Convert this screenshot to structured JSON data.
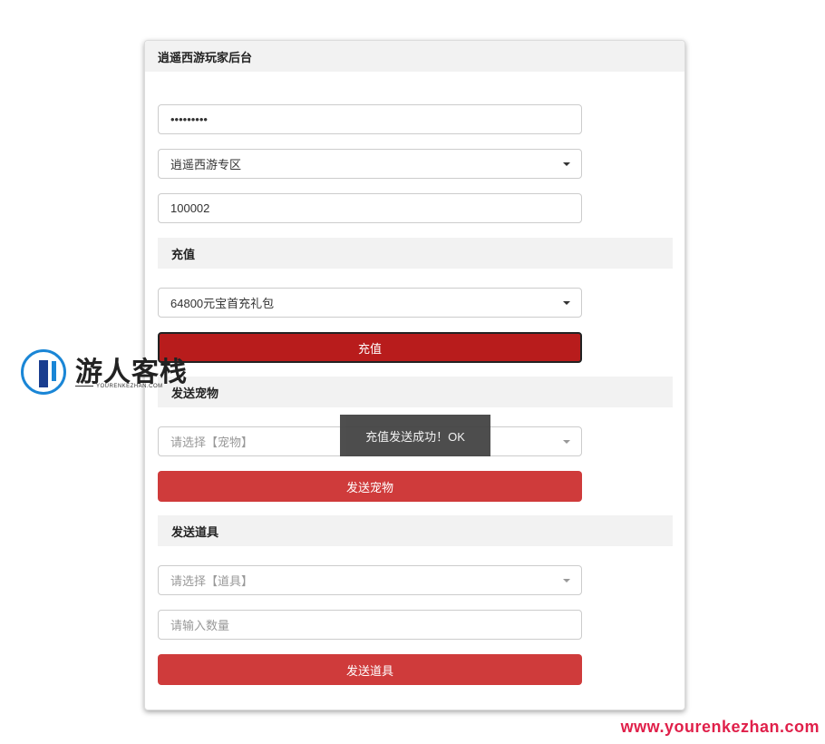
{
  "panel": {
    "title": "逍遥西游玩家后台"
  },
  "form": {
    "password_value": "•••••••••",
    "zone_selected": "逍遥西游专区",
    "account_value": "100002"
  },
  "recharge": {
    "section_title": "充值",
    "package_selected": "64800元宝首充礼包",
    "button_label": "充值"
  },
  "pet": {
    "section_title": "发送宠物",
    "select_placeholder": "请选择【宠物】",
    "button_label": "发送宠物"
  },
  "item": {
    "section_title": "发送道具",
    "select_placeholder": "请选择【道具】",
    "quantity_placeholder": "请输入数量",
    "button_label": "发送道具"
  },
  "toast": {
    "message": "充值发送成功！OK"
  },
  "logo": {
    "name": "游人客栈",
    "subtitle": "YOURENKEZHAN.COM"
  },
  "watermark": {
    "text": "www.yourenkezhan.com"
  },
  "colors": {
    "button": "#cf3b3b",
    "button_active": "#b81c1c",
    "section_bg": "#f2f2f2",
    "toast_bg": "#444444"
  }
}
